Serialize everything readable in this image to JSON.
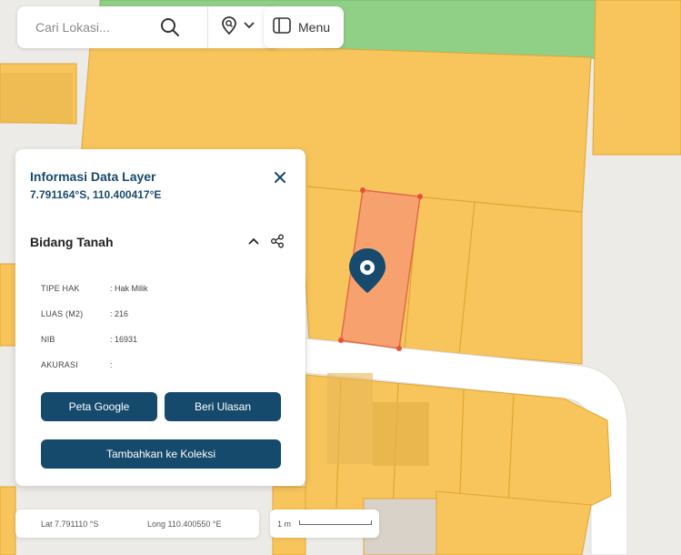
{
  "search": {
    "placeholder": "Cari Lokasi..."
  },
  "menu": {
    "label": "Menu"
  },
  "info_panel": {
    "title": "Informasi Data Layer",
    "coords": "7.791164°S, 110.400417°E",
    "section_title": "Bidang Tanah",
    "attributes": [
      {
        "key": "TIPE HAK",
        "value": ": Hak Milik"
      },
      {
        "key": "LUAS (M2)",
        "value": ": 216"
      },
      {
        "key": "NIB",
        "value": ": 16931"
      },
      {
        "key": "AKURASI",
        "value": ":"
      }
    ],
    "buttons": {
      "google": "Peta Google",
      "review": "Beri Ulasan",
      "collection": "Tambahkan ke Koleksi"
    }
  },
  "coordinate_bar": {
    "lat": "Lat 7.791110 °S",
    "lng": "Long 110.400550 °E"
  },
  "scale": {
    "label": "1 m"
  },
  "colors": {
    "parcel": "#f8c45c",
    "parcel_border": "#e0a632",
    "selected_parcel": "#f7a26e",
    "green_area": "#8fcf86",
    "road": "#ffffff",
    "background": "#ecebe8",
    "accent": "#174a6c",
    "marker": "#174a6c"
  }
}
